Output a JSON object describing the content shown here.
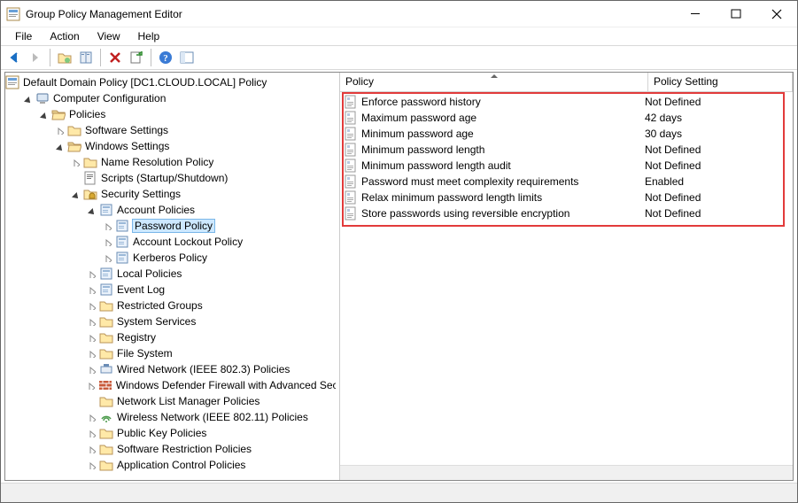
{
  "window": {
    "title": "Group Policy Management Editor"
  },
  "menu": {
    "file": "File",
    "action": "Action",
    "view": "View",
    "help": "Help"
  },
  "headers": {
    "policy": "Policy",
    "setting": "Policy Setting"
  },
  "tree": {
    "root": "Default Domain Policy [DC1.CLOUD.LOCAL] Policy",
    "computer_config": "Computer Configuration",
    "policies": "Policies",
    "software_settings": "Software Settings",
    "windows_settings": "Windows Settings",
    "name_resolution": "Name Resolution Policy",
    "scripts": "Scripts (Startup/Shutdown)",
    "security_settings": "Security Settings",
    "account_policies": "Account Policies",
    "password_policy": "Password Policy",
    "account_lockout": "Account Lockout Policy",
    "kerberos": "Kerberos Policy",
    "local_policies": "Local Policies",
    "event_log": "Event Log",
    "restricted_groups": "Restricted Groups",
    "system_services": "System Services",
    "registry": "Registry",
    "file_system": "File System",
    "wired_network": "Wired Network (IEEE 802.3) Policies",
    "defender_firewall": "Windows Defender Firewall with Advanced Security",
    "network_list": "Network List Manager Policies",
    "wireless_network": "Wireless Network (IEEE 802.11) Policies",
    "public_key": "Public Key Policies",
    "software_restriction": "Software Restriction Policies",
    "app_control": "Application Control Policies"
  },
  "list": [
    {
      "name": "Enforce password history",
      "setting": "Not Defined"
    },
    {
      "name": "Maximum password age",
      "setting": "42 days"
    },
    {
      "name": "Minimum password age",
      "setting": "30 days"
    },
    {
      "name": "Minimum password length",
      "setting": "Not Defined"
    },
    {
      "name": "Minimum password length audit",
      "setting": "Not Defined"
    },
    {
      "name": "Password must meet complexity requirements",
      "setting": "Enabled"
    },
    {
      "name": "Relax minimum password length limits",
      "setting": "Not Defined"
    },
    {
      "name": "Store passwords using reversible encryption",
      "setting": "Not Defined"
    }
  ]
}
